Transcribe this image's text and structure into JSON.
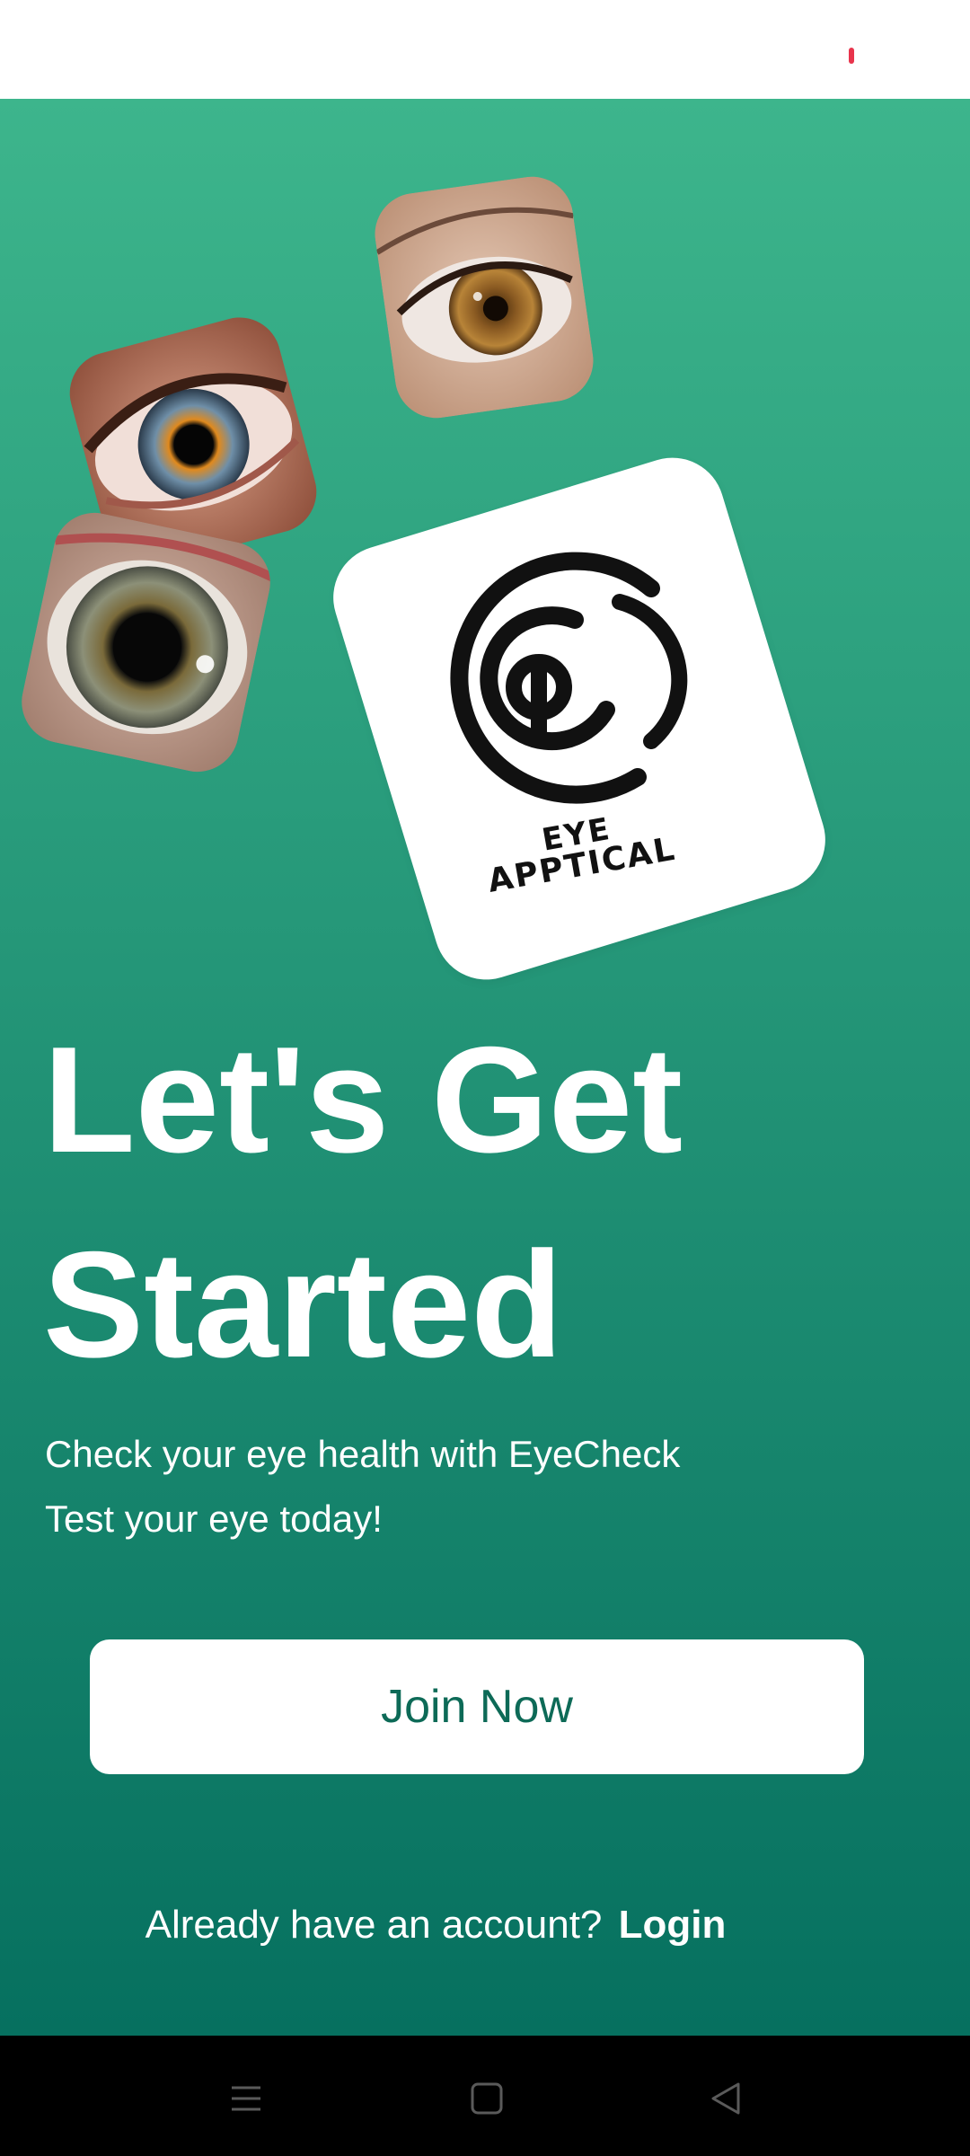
{
  "status_bar": {
    "indicator_color": "#e8344c"
  },
  "colors": {
    "gradient_top": "#3db58c",
    "gradient_bottom": "#06705f",
    "button_text": "#0d6a57"
  },
  "hero_images": [
    {
      "name": "brown-eye-photo"
    },
    {
      "name": "blue-orange-eye-photo"
    },
    {
      "name": "grey-green-eye-photo"
    }
  ],
  "logo": {
    "line1": "EYE",
    "line2": "APPTICAL"
  },
  "headline": {
    "line1": "Let's Get",
    "line2": "Started"
  },
  "subtext": {
    "line1": "Check your eye health with EyeCheck",
    "line2": "Test your eye today!"
  },
  "join_button": {
    "label": "Join Now"
  },
  "login_prompt": {
    "text": "Already have an account?",
    "link": "Login"
  },
  "nav_bar": {
    "icons": [
      "menu-icon",
      "home-square-icon",
      "back-triangle-icon"
    ]
  }
}
